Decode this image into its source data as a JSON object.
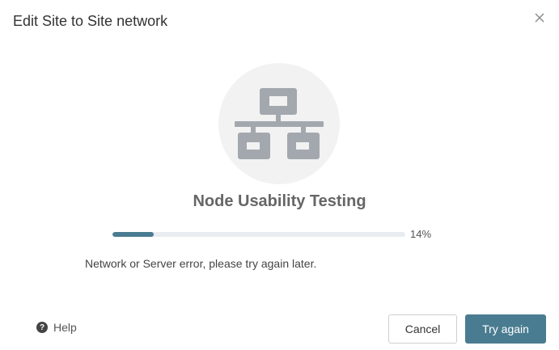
{
  "dialog": {
    "title": "Edit Site to Site network",
    "heading": "Node Usability Testing",
    "progress": {
      "percent": 14,
      "label": "14%"
    },
    "error_message": "Network or Server error, please try again later.",
    "help_label": "Help",
    "cancel_label": "Cancel",
    "primary_label": "Try again"
  },
  "icons": {
    "close": "close-icon",
    "network": "network-topology-icon",
    "help": "question-circle-icon"
  },
  "colors": {
    "accent": "#4a7c91",
    "track": "#e9edf1",
    "illustration_bg": "#f2f2f2",
    "illustration_fg": "#a3a8ae"
  }
}
